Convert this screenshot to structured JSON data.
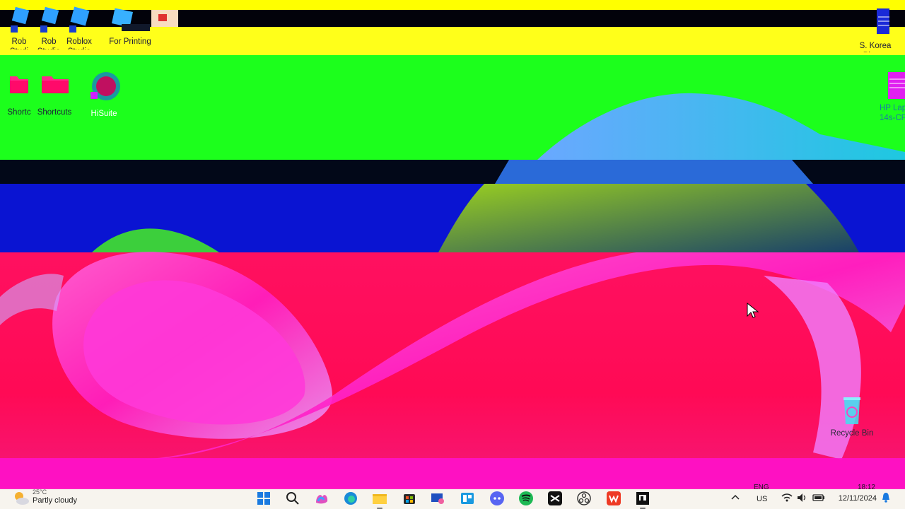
{
  "desktop": {
    "icons_top": [
      {
        "label": "Rob\nStudi",
        "icon": "roblox-studio-icon"
      },
      {
        "label": "Rob\nStudio",
        "icon": "roblox-studio-icon"
      },
      {
        "label": "Roblox\nStudio",
        "icon": "roblox-studio-icon"
      },
      {
        "label": "For Printing",
        "icon": "folder-icon"
      }
    ],
    "icons_row2": [
      {
        "label": "Shortc",
        "icon": "folder-icon"
      },
      {
        "label": "Shortcuts",
        "icon": "folder-icon"
      },
      {
        "label": "HiSuite",
        "icon": "hisuite-icon"
      }
    ],
    "right_icons": [
      {
        "label": "S. Korea\nPlaces",
        "icon": "document-icon"
      },
      {
        "label": "HP Lap\n14s-CF",
        "icon": "document-icon"
      }
    ],
    "recycle_bin": "Recycle Bin"
  },
  "taskbar": {
    "weather": {
      "temp": "25°C",
      "condition": "Partly cloudy"
    },
    "language": {
      "line1": "ENG",
      "line2": "US"
    },
    "clock": {
      "time": "18:12",
      "date": "12/11/2024"
    },
    "pinned": [
      "start-icon",
      "search-icon",
      "copilot-icon",
      "edge-icon",
      "file-explorer-icon",
      "store-icon",
      "snipping-tool-icon",
      "widgets-icon",
      "discord-icon",
      "spotify-icon",
      "capcut-icon",
      "obs-icon",
      "wps-icon",
      "presentation-icon"
    ]
  },
  "colors": {
    "yellow": "#ffff1a",
    "green": "#1cff1c",
    "blue": "#0a14d2",
    "red": "#ff0a55",
    "magenta": "#ff10d0",
    "taskbar": "#f7f4ee"
  }
}
